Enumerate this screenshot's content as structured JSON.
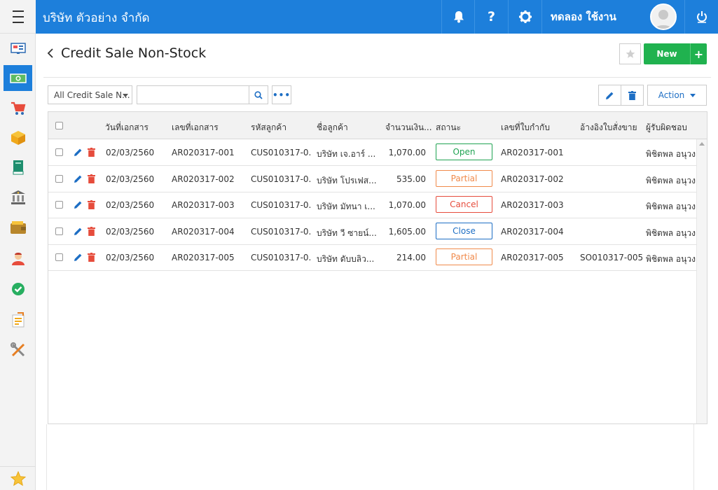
{
  "header": {
    "company": "บริษัท ตัวอย่าง จำกัด",
    "user": "ทดลอง ใช้งาน",
    "icons": [
      "menu-icon",
      "bell-icon",
      "help-icon",
      "gear-icon",
      "power-icon"
    ]
  },
  "sidebar": {
    "items": [
      "dashboard-icon",
      "money-icon",
      "cart-icon",
      "box-icon",
      "book-icon",
      "bank-icon",
      "wallet-icon",
      "contacts-icon",
      "check-icon",
      "report-icon",
      "tools-icon"
    ],
    "active": "money-icon",
    "favorite": "star-icon"
  },
  "page": {
    "title": "Credit Sale Non-Stock",
    "new_label": "New",
    "plus_label": "+",
    "action_label": "Action"
  },
  "filter": {
    "selected": "All Credit Sale N...",
    "search_value": "",
    "more_label": "•••"
  },
  "table": {
    "columns": [
      "วันที่เอกสาร",
      "เลขที่เอกสาร",
      "รหัสลูกค้า",
      "ชื่อลูกค้า",
      "จำนวนเงิน...",
      "สถานะ",
      "เลขที่ใบกำกับ",
      "อ้างอิงใบสั่งขาย",
      "ผู้รับผิดชอบ"
    ],
    "rows": [
      {
        "date": "02/03/2560",
        "doc_no": "AR020317-001",
        "cust_code": "CUS010317-0...",
        "cust_name": "บริษัท เจ.อาร์ ...",
        "amount": "1,070.00",
        "status": "Open",
        "invoice_no": "AR020317-001",
        "so_ref": "",
        "owner": "พิชิตพล อนุวง"
      },
      {
        "date": "02/03/2560",
        "doc_no": "AR020317-002",
        "cust_code": "CUS010317-0...",
        "cust_name": "บริษัท โปรเฟส...",
        "amount": "535.00",
        "status": "Partial",
        "invoice_no": "AR020317-002",
        "so_ref": "",
        "owner": "พิชิตพล อนุวง"
      },
      {
        "date": "02/03/2560",
        "doc_no": "AR020317-003",
        "cust_code": "CUS010317-0...",
        "cust_name": "บริษัท มัทนา เ...",
        "amount": "1,070.00",
        "status": "Cancel",
        "invoice_no": "AR020317-003",
        "so_ref": "",
        "owner": "พิชิตพล อนุวง"
      },
      {
        "date": "02/03/2560",
        "doc_no": "AR020317-004",
        "cust_code": "CUS010317-0...",
        "cust_name": "บริษัท วี ซายน์...",
        "amount": "1,605.00",
        "status": "Close",
        "invoice_no": "AR020317-004",
        "so_ref": "",
        "owner": "พิชิตพล อนุวง"
      },
      {
        "date": "02/03/2560",
        "doc_no": "AR020317-005",
        "cust_code": "CUS010317-0...",
        "cust_name": "บริษัท ดับบลิว...",
        "amount": "214.00",
        "status": "Partial",
        "invoice_no": "AR020317-005",
        "so_ref": "SO010317-005",
        "owner": "พิชิตพล อนุวง"
      }
    ]
  },
  "colors": {
    "primary": "#1d7fdb",
    "new_button": "#20b24f",
    "status_open": "#20a352",
    "status_partial": "#f08a4b",
    "status_cancel": "#e64c3c",
    "status_close": "#1d6ec4"
  }
}
